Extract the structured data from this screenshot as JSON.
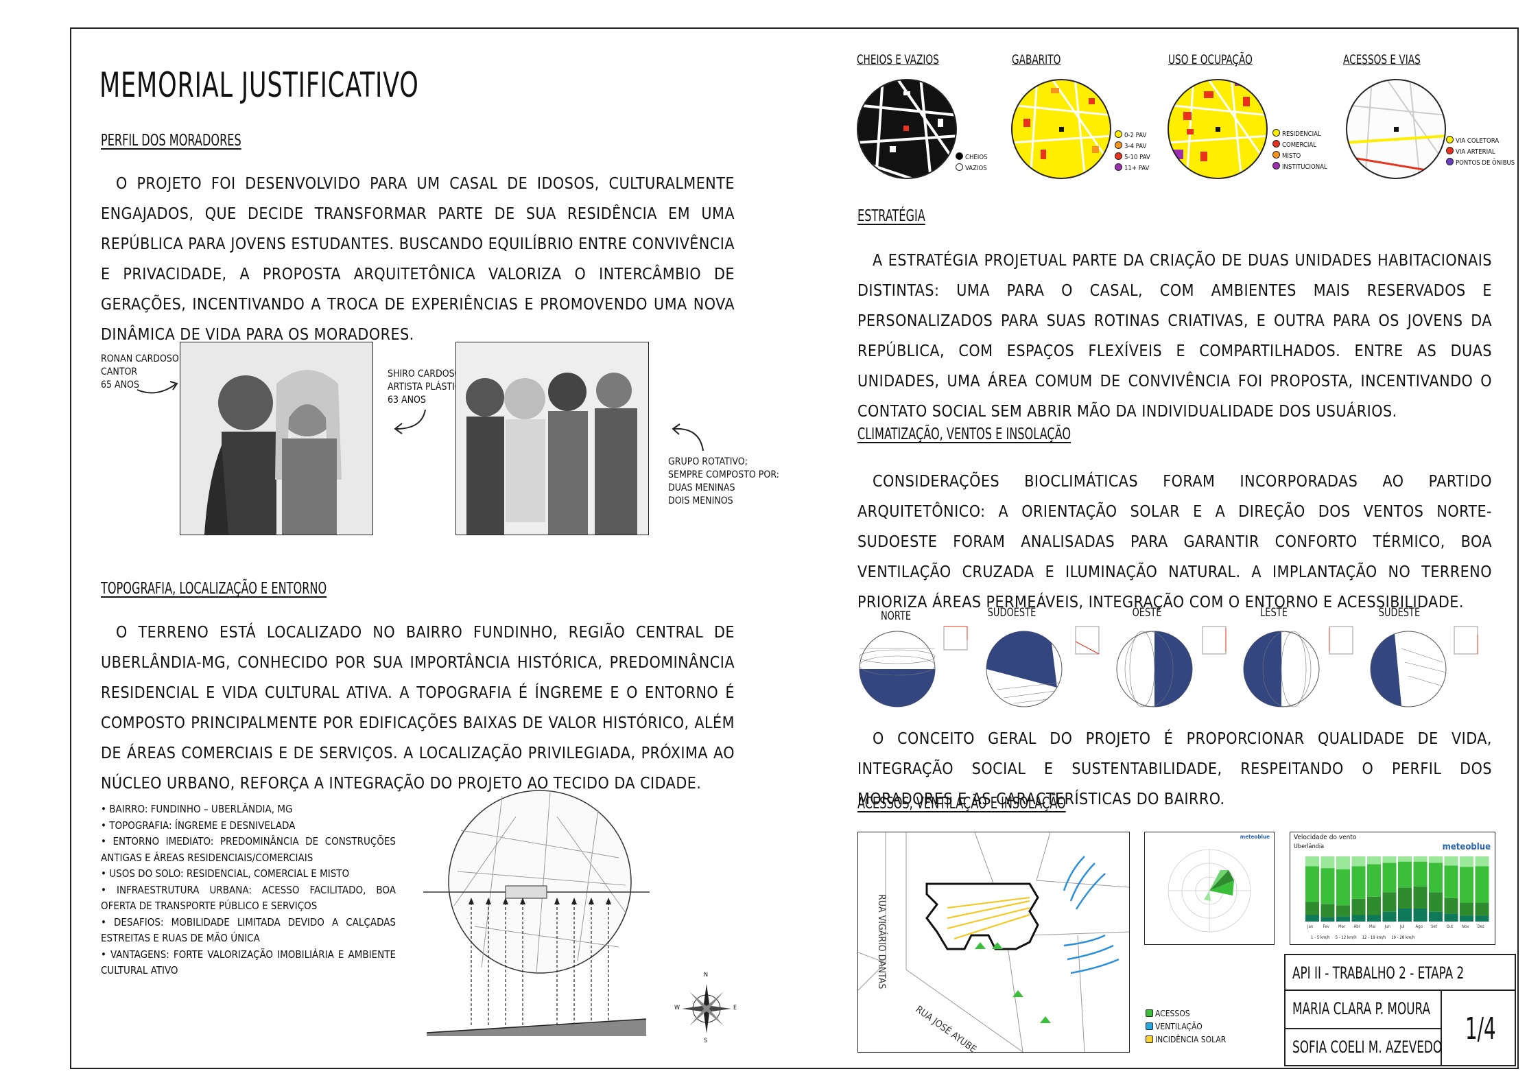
{
  "title": "MEMORIAL JUSTIFICATIVO",
  "perfil": {
    "heading": "PERFIL DOS MORADORES",
    "text": "O projeto foi desenvolvido para um casal de idosos, culturalmente engajados, que decide transformar parte de sua residência em uma república para jovens estudantes. Buscando equilíbrio entre convivência e privacidade, a proposta arquitetônica valoriza o intercâmbio de gerações, incentivando a troca de experiências e promovendo uma nova dinâmica de vida para os moradores.",
    "ronan": [
      "RONAN CARDOSO",
      "CANTOR",
      "65 ANOS"
    ],
    "shiro": [
      "SHIRO CARDOSO",
      "ARTISTA PLÁSTICA",
      "63 ANOS"
    ],
    "grupo": [
      "GRUPO ROTATIVO;",
      "SEMPRE COMPOSTO POR:",
      "DUAS MENINAS",
      "DOIS MENINOS"
    ]
  },
  "topo": {
    "heading": "TOPOGRAFIA, LOCALIZAÇÃO E ENTORNO",
    "text": "O terreno está localizado no bairro Fundinho, região central de Uberlândia-MG, conhecido por sua importância histórica, predominância residencial e vida cultural ativa. A topografia é íngreme e o entorno é composto principalmente por edificações baixas de valor histórico, além de áreas comerciais e de serviços. A localização privilegiada, próxima ao núcleo urbano, reforça a integração do projeto ao tecido da cidade.",
    "bullets": [
      "• Bairro: Fundinho – Uberlândia, MG",
      "• Topografia: Íngreme e desnivelada",
      "• Entorno imediato: Predominância de construções antigas e áreas residenciais/comerciais",
      "• Usos do solo: Residencial, comercial e misto",
      "• Infraestrutura urbana: Acesso facilitado, boa oferta de transporte público e serviços",
      "• Desafios: Mobilidade limitada devido a calçadas estreitas e ruas de mão única",
      "• Vantagens: Forte valorização imobiliária e ambiente cultural ativo"
    ],
    "compass": {
      "n": "N",
      "s": "S",
      "e": "E",
      "w": "W"
    }
  },
  "maps": [
    {
      "title": "CHEIOS E VAZIOS",
      "legend": [
        {
          "label": "CHEIOS",
          "color": "#000000"
        },
        {
          "label": "VAZIOS",
          "color": "#ffffff"
        }
      ]
    },
    {
      "title": "GABARITO",
      "legend": [
        {
          "label": "0-2 PAV",
          "color": "#ffee00"
        },
        {
          "label": "3-4 PAV",
          "color": "#f7941d"
        },
        {
          "label": "5-10 PAV",
          "color": "#e8321e"
        },
        {
          "label": "11+ PAV",
          "color": "#9b2fae"
        }
      ]
    },
    {
      "title": "USO E OCUPAÇÃO",
      "legend": [
        {
          "label": "RESIDENCIAL",
          "color": "#ffee00"
        },
        {
          "label": "COMERCIAL",
          "color": "#e8321e"
        },
        {
          "label": "MISTO",
          "color": "#f7941d"
        },
        {
          "label": "INSTITUCIONAL",
          "color": "#9b2fae"
        }
      ]
    },
    {
      "title": "ACESSOS E VIAS",
      "legend": [
        {
          "label": "VIA COLETORA",
          "color": "#ffee00"
        },
        {
          "label": "VIA ARTERIAL",
          "color": "#e8321e"
        },
        {
          "label": "PONTOS DE ÔNIBUS",
          "color": "#6a3fbf"
        }
      ]
    }
  ],
  "estrategia": {
    "heading": "ESTRATÉGIA",
    "text": "A estratégia projetual parte da criação de duas unidades habitacionais distintas: uma para o casal, com ambientes mais reservados e personalizados para suas rotinas criativas, e outra para os jovens da república, com espaços flexíveis e compartilhados. Entre as duas unidades, uma área comum de convivência foi proposta, incentivando o contato social sem abrir mão da individualidade dos usuários."
  },
  "clima": {
    "heading": "CLIMATIZAÇÃO, VENTOS E INSOLAÇÃO",
    "text": "Considerações bioclimáticas foram incorporadas ao partido arquitetônico: a orientação solar e a direção dos ventos norte-sudoeste foram analisadas para garantir conforto térmico, boa ventilação cruzada e iluminação natural. A implantação no terreno prioriza áreas permeáveis, integração com o entorno e acessibilidade.",
    "suns": [
      {
        "label": "NORTE",
        "fill": "bottom"
      },
      {
        "label": "SUDOESTE",
        "fill": "upperleft"
      },
      {
        "label": "OESTE",
        "fill": "right"
      },
      {
        "label": "LESTE",
        "fill": "left"
      },
      {
        "label": "SUDESTE",
        "fill": "lowleft"
      }
    ]
  },
  "conceito": {
    "text": "O conceito geral do projeto é proporcionar qualidade de vida, integração social e sustentabilidade, respeitando o perfil dos moradores e as características do bairro."
  },
  "acessos": {
    "heading": "ACESSOS, VENTILAÇÃO E INSOLAÇÃO",
    "street1": "RUA VIGÁRIO DANTAS",
    "street2": "RUA JOSÉ AYUBE",
    "legend": [
      {
        "label": "ACESSOS",
        "color": "#3bbf3b"
      },
      {
        "label": "VENTILAÇÃO",
        "color": "#2aa6e0"
      },
      {
        "label": "INCIDÊNCIA SOLAR",
        "color": "#f5d130"
      }
    ]
  },
  "meteo": {
    "title": "Velocidade do vento",
    "city": "Uberlândia",
    "brand": "meteoblue",
    "months": [
      "Jan",
      "Fev",
      "Mar",
      "Abr",
      "Mai",
      "Jun",
      "Jul",
      "Ago",
      "Set",
      "Out",
      "Nov",
      "Dez"
    ],
    "legend": [
      "1 - 5 km/h",
      "5 - 12 km/h",
      "12 - 19 km/h",
      "19 - 28 km/h"
    ]
  },
  "titleblock": {
    "course": "API II - TRABALHO 2 - ETAPA 2",
    "author1": "MARIA CLARA P. MOURA",
    "author2": "SOFIA COELI M. AZEVEDO",
    "sheet": "1/4"
  }
}
